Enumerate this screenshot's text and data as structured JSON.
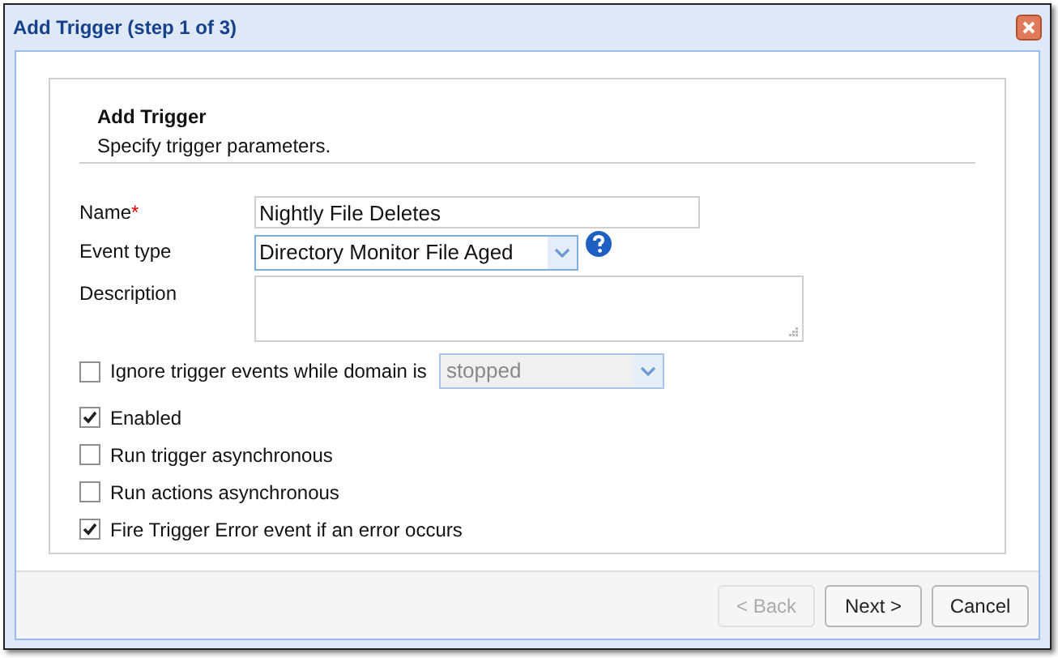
{
  "window": {
    "title": "Add Trigger (step 1 of 3)"
  },
  "header": {
    "title": "Add Trigger",
    "subtitle": "Specify trigger parameters."
  },
  "name_field": {
    "label": "Name",
    "required_mark": "*",
    "value": "Nightly File Deletes"
  },
  "event_type": {
    "label": "Event type",
    "value": "Directory Monitor File Aged"
  },
  "description": {
    "label": "Description"
  },
  "ignore": {
    "label": "Ignore trigger events while domain is",
    "checked": false,
    "select": {
      "value": "stopped",
      "disabled": true
    }
  },
  "checkboxes": [
    {
      "label": "Enabled",
      "checked": true
    },
    {
      "label": "Run trigger asynchronous",
      "checked": false
    },
    {
      "label": "Run actions asynchronous",
      "checked": false
    },
    {
      "label": "Fire Trigger Error event if an error occurs",
      "checked": true
    }
  ],
  "buttons": [
    {
      "label": "< Back",
      "disabled": true
    },
    {
      "label": "Next >",
      "disabled": false
    },
    {
      "label": "Cancel",
      "disabled": false
    }
  ]
}
